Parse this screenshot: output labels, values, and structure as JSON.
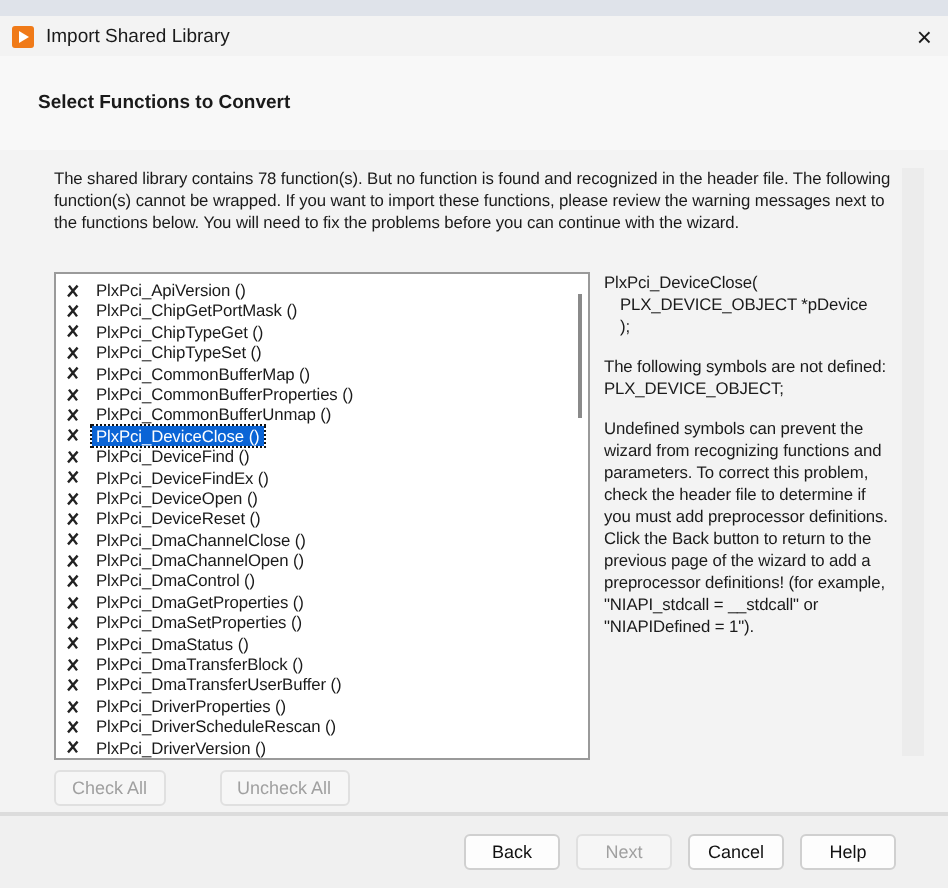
{
  "window": {
    "title": "Import Shared Library",
    "close": "×"
  },
  "header": {
    "title": "Select Functions to Convert"
  },
  "description": "The shared library contains 78 function(s). But no function is found and recognized in the header file. The following function(s) cannot be wrapped. If you want to import these functions, please review the warning messages next to the functions below. You will need to fix the problems before you can continue with the wizard.",
  "functions": [
    {
      "name": "PlxPci_ApiVersion ()",
      "wrappable": false,
      "selected": false
    },
    {
      "name": "PlxPci_ChipGetPortMask ()",
      "wrappable": false,
      "selected": false
    },
    {
      "name": "PlxPci_ChipTypeGet ()",
      "wrappable": false,
      "selected": false
    },
    {
      "name": "PlxPci_ChipTypeSet ()",
      "wrappable": false,
      "selected": false
    },
    {
      "name": "PlxPci_CommonBufferMap ()",
      "wrappable": false,
      "selected": false
    },
    {
      "name": "PlxPci_CommonBufferProperties ()",
      "wrappable": false,
      "selected": false
    },
    {
      "name": "PlxPci_CommonBufferUnmap ()",
      "wrappable": false,
      "selected": false
    },
    {
      "name": "PlxPci_DeviceClose ()",
      "wrappable": false,
      "selected": true
    },
    {
      "name": "PlxPci_DeviceFind ()",
      "wrappable": false,
      "selected": false
    },
    {
      "name": "PlxPci_DeviceFindEx ()",
      "wrappable": false,
      "selected": false
    },
    {
      "name": "PlxPci_DeviceOpen ()",
      "wrappable": false,
      "selected": false
    },
    {
      "name": "PlxPci_DeviceReset ()",
      "wrappable": false,
      "selected": false
    },
    {
      "name": "PlxPci_DmaChannelClose ()",
      "wrappable": false,
      "selected": false
    },
    {
      "name": "PlxPci_DmaChannelOpen ()",
      "wrappable": false,
      "selected": false
    },
    {
      "name": "PlxPci_DmaControl ()",
      "wrappable": false,
      "selected": false
    },
    {
      "name": "PlxPci_DmaGetProperties ()",
      "wrappable": false,
      "selected": false
    },
    {
      "name": "PlxPci_DmaSetProperties ()",
      "wrappable": false,
      "selected": false
    },
    {
      "name": "PlxPci_DmaStatus ()",
      "wrappable": false,
      "selected": false
    },
    {
      "name": "PlxPci_DmaTransferBlock ()",
      "wrappable": false,
      "selected": false
    },
    {
      "name": "PlxPci_DmaTransferUserBuffer ()",
      "wrappable": false,
      "selected": false
    },
    {
      "name": "PlxPci_DriverProperties ()",
      "wrappable": false,
      "selected": false
    },
    {
      "name": "PlxPci_DriverScheduleRescan ()",
      "wrappable": false,
      "selected": false
    },
    {
      "name": "PlxPci_DriverVersion ()",
      "wrappable": false,
      "selected": false
    }
  ],
  "details": {
    "signature": [
      "PlxPci_DeviceClose(",
      "PLX_DEVICE_OBJECT *pDevice",
      ");"
    ],
    "message": "The following symbols are not defined:",
    "symbols": "PLX_DEVICE_OBJECT;",
    "advice": "Undefined symbols can prevent the wizard from recognizing functions and parameters. To correct this problem, check the header file to determine if you must add preprocessor definitions. Click the Back button to return to the previous page of the wizard to add a preprocessor definitions! (for example, \"NIAPI_stdcall = __stdcall\" or \"NIAPIDefined = 1\")."
  },
  "list_buttons": [
    {
      "label": "Check All",
      "disabled": true
    },
    {
      "label": "Uncheck All",
      "disabled": true
    }
  ],
  "footer_buttons": [
    {
      "label": "Back",
      "disabled": false
    },
    {
      "label": "Next",
      "disabled": true
    },
    {
      "label": "Cancel",
      "disabled": false
    },
    {
      "label": "Help",
      "disabled": false
    }
  ]
}
